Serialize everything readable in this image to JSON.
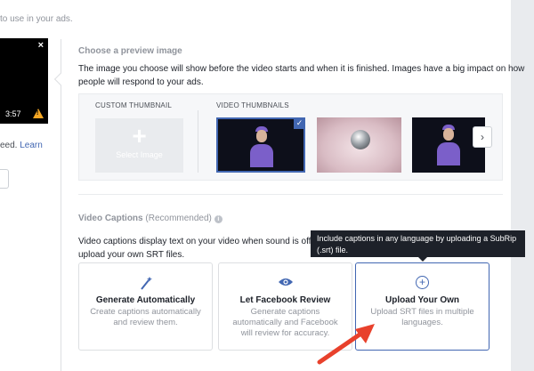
{
  "left": {
    "top_text": "to use in your ads.",
    "video": {
      "duration": "3:57",
      "close": "×",
      "warning": "!"
    },
    "note_prefix": "eed.",
    "note_link": "Learn"
  },
  "preview": {
    "title": "Choose a preview image",
    "desc_line1": "The image you choose will show before the video starts and when it is finished. Images have a big impact on how",
    "desc_line2": "people will respond to your ads.",
    "custom_label": "CUSTOM THUMBNAIL",
    "select_plus": "+",
    "select_label": "Select Image",
    "video_label": "VIDEO THUMBNAILS",
    "check": "✓",
    "next": "›"
  },
  "captions": {
    "title": "Video Captions",
    "recommended": "(Recommended)",
    "info": "i",
    "desc_line1": "Video captions display text on your video when sound is off. Yo",
    "desc_line2": "upload your own SRT files.",
    "tooltip_line1": "Include captions in any language by uploading a SubRip",
    "tooltip_line2": "(.srt) file.",
    "cards": [
      {
        "title": "Generate Automatically",
        "desc": "Create captions automatically and review them.",
        "icon": "magic-wand-icon"
      },
      {
        "title": "Let Facebook Review",
        "desc": "Generate captions automatically and Facebook will review for accuracy.",
        "icon": "eye-icon"
      },
      {
        "title": "Upload Your Own",
        "desc": "Upload SRT files in multiple languages.",
        "icon": "plus-circle-icon"
      }
    ]
  },
  "colors": {
    "accent": "#4267b2",
    "warning": "#f5a623",
    "arrow": "#e8412c",
    "tooltip": "#1d2129"
  }
}
